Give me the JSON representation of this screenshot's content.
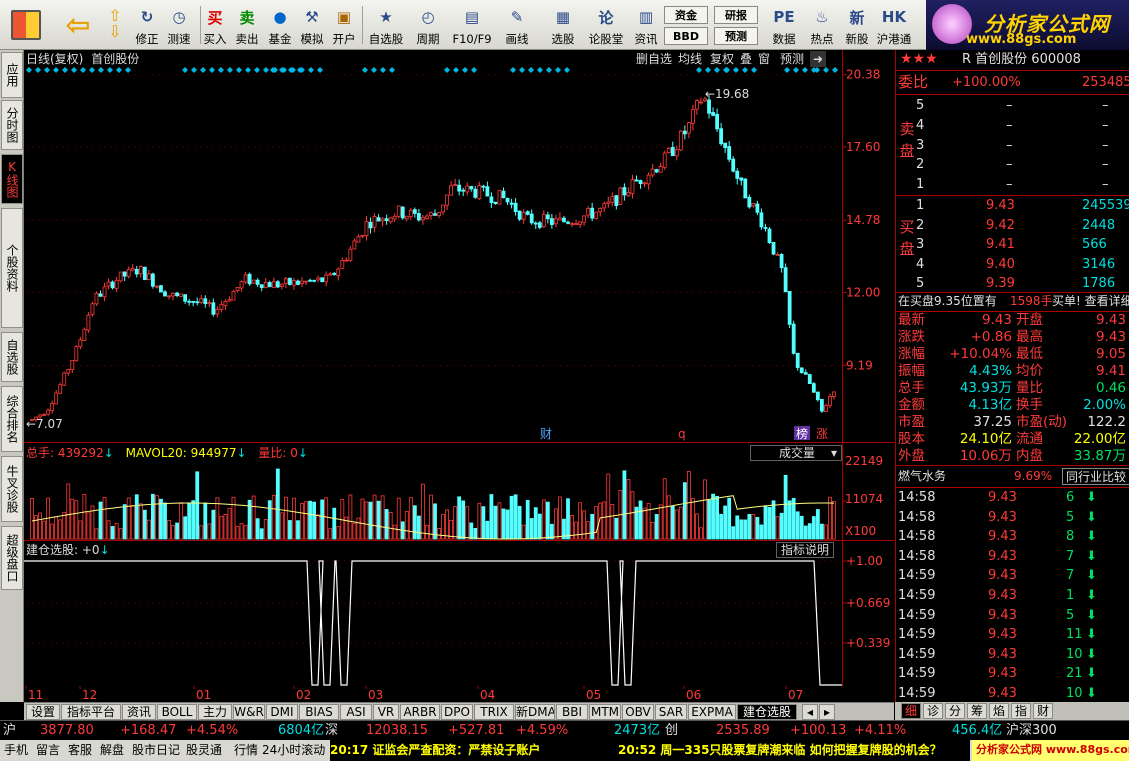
{
  "toolbar": {
    "items": [
      {
        "id": "revise",
        "label": "修正",
        "icon": "revise-icon",
        "glyph": "↻"
      },
      {
        "id": "speed",
        "label": "测速",
        "icon": "clock-icon",
        "glyph": "◷"
      },
      {
        "id": "buy",
        "label": "买入",
        "icon": "buy-icon",
        "glyph": "买"
      },
      {
        "id": "sell",
        "label": "卖出",
        "icon": "sell-icon",
        "glyph": "卖"
      },
      {
        "id": "fund",
        "label": "基金",
        "icon": "fund-icon",
        "glyph": "●"
      },
      {
        "id": "simulate",
        "label": "模拟",
        "icon": "hammer-icon",
        "glyph": "⚒"
      },
      {
        "id": "open_account",
        "label": "开户",
        "icon": "lock-icon",
        "glyph": "▣"
      },
      {
        "id": "watchlist",
        "label": "自选股",
        "icon": "star-folder-icon",
        "glyph": "★"
      },
      {
        "id": "period",
        "label": "周期",
        "icon": "period-icon",
        "glyph": "◴"
      },
      {
        "id": "f10",
        "label": "F10/F9",
        "icon": "f10-icon",
        "glyph": "▤"
      },
      {
        "id": "draw",
        "label": "画线",
        "icon": "pen-icon",
        "glyph": "✎"
      },
      {
        "id": "select",
        "label": "选股",
        "icon": "select-icon",
        "glyph": "▦"
      },
      {
        "id": "forum",
        "label": "论股堂",
        "icon": "forum-icon",
        "glyph": "论"
      },
      {
        "id": "info",
        "label": "资讯",
        "icon": "info-icon",
        "glyph": "▥"
      },
      {
        "id": "data",
        "label": "数据",
        "icon": "pe-icon",
        "glyph": "PE"
      },
      {
        "id": "hot",
        "label": "热点",
        "icon": "fire-icon",
        "glyph": "♨"
      },
      {
        "id": "new_stock",
        "label": "新股",
        "icon": "new-stock-icon",
        "glyph": "新"
      },
      {
        "id": "hk_connect",
        "label": "沪港通",
        "icon": "hk-connect-icon",
        "glyph": "HK"
      }
    ],
    "small_buttons": {
      "funds": "资金",
      "research": "研报",
      "bbd": "BBD",
      "forecast": "预测"
    },
    "brand_title": "分析家公式网",
    "brand_url": "www.88gs.com"
  },
  "left_tabs": [
    "应用",
    "分时图",
    "K线图",
    "个股资料",
    "自选股",
    "综合排名",
    "牛叉诊股",
    "超级盘口"
  ],
  "main_chart": {
    "title": "日线(复权)",
    "stock_name": "首创股份",
    "header_buttons": [
      "删自选",
      "均线",
      "复权",
      "叠",
      "窗",
      "预测"
    ],
    "price_labels": [
      "20.38",
      "17.60",
      "14.78",
      "12.00",
      "9.19"
    ],
    "high_label": "19.68",
    "low_label": "7.07",
    "markers": [
      {
        "text": "财",
        "color": "#4da6ff"
      },
      {
        "text": "q",
        "color": "#ff3a3a"
      },
      {
        "text": "榜",
        "color": "#ffffff"
      },
      {
        "text": "涨",
        "color": "#ff3a3a"
      }
    ]
  },
  "chart_data": {
    "type": "candlestick",
    "y_range": [
      6.9,
      20.6
    ],
    "x_month_labels": [
      "11",
      "12",
      "01",
      "02",
      "03",
      "04",
      "05",
      "06",
      "07"
    ],
    "waypoints": [
      [
        0,
        7.1
      ],
      [
        10,
        7.5
      ],
      [
        20,
        8.6
      ],
      [
        30,
        9.9
      ],
      [
        40,
        11.7
      ],
      [
        55,
        12.5
      ],
      [
        70,
        12.9
      ],
      [
        90,
        11.9
      ],
      [
        110,
        11.6
      ],
      [
        120,
        11.3
      ],
      [
        140,
        12.5
      ],
      [
        160,
        12.3
      ],
      [
        180,
        12.4
      ],
      [
        195,
        12.5
      ],
      [
        205,
        13.3
      ],
      [
        220,
        14.7
      ],
      [
        240,
        15.1
      ],
      [
        255,
        14.9
      ],
      [
        265,
        15.0
      ],
      [
        275,
        16.0
      ],
      [
        290,
        15.9
      ],
      [
        310,
        15.6
      ],
      [
        325,
        14.8
      ],
      [
        345,
        14.7
      ],
      [
        360,
        14.9
      ],
      [
        375,
        15.2
      ],
      [
        395,
        16.2
      ],
      [
        415,
        17.1
      ],
      [
        430,
        18.3
      ],
      [
        440,
        19.6
      ],
      [
        450,
        18.2
      ],
      [
        465,
        16.1
      ],
      [
        480,
        14.6
      ],
      [
        492,
        12.8
      ],
      [
        500,
        9.4
      ],
      [
        510,
        8.5
      ],
      [
        518,
        7.4
      ],
      [
        526,
        8.3
      ]
    ],
    "volume": {
      "label": "总手",
      "value": "439292",
      "ma_label": "MAVOL20",
      "ma_value": "944977",
      "ratio_label": "量比",
      "ratio_value": "0",
      "scale_labels": [
        "22149",
        "11074",
        "X100"
      ]
    },
    "indicator": {
      "label": "建仓选股",
      "value": "+0",
      "scale_labels": [
        "+1.00",
        "+0.669",
        "+0.339"
      ],
      "spike_positions": [
        283,
        295,
        312,
        583,
        596
      ],
      "spike_end": 790
    }
  },
  "volume_dropdown": "成交量",
  "indicator_button": "指标说明",
  "bottom_tabs": [
    "设置",
    "指标平台",
    "资讯",
    "BOLL",
    "主力",
    "W&R",
    "DMI",
    "BIAS",
    "ASI",
    "VR",
    "ARBR",
    "DPO",
    "TRIX",
    "新DMA",
    "BBI",
    "MTM",
    "OBV",
    "SAR",
    "EXPMA",
    "建仓选股"
  ],
  "right_panel": {
    "stars": "★★★",
    "stock_code": "R 首创股份 600008",
    "wei_bi_label": "委比",
    "wei_bi": "+100.00%",
    "wei_cha": "253485",
    "sell_label": "卖盘",
    "buy_label": "买盘",
    "sell_levels": [
      {
        "n": "5",
        "p": "–",
        "v": "–"
      },
      {
        "n": "4",
        "p": "–",
        "v": "–"
      },
      {
        "n": "3",
        "p": "–",
        "v": "–"
      },
      {
        "n": "2",
        "p": "–",
        "v": "–"
      },
      {
        "n": "1",
        "p": "–",
        "v": "–"
      }
    ],
    "buy_levels": [
      {
        "n": "1",
        "p": "9.43",
        "v": "245539"
      },
      {
        "n": "2",
        "p": "9.42",
        "v": "2448"
      },
      {
        "n": "3",
        "p": "9.41",
        "v": "566"
      },
      {
        "n": "4",
        "p": "9.40",
        "v": "3146"
      },
      {
        "n": "5",
        "p": "9.39",
        "v": "1786"
      }
    ],
    "buy_note": "在买盘9.35位置有",
    "buy_note_qty": "1598手",
    "buy_note_link": "买单! 查看详细",
    "stats": [
      {
        "l1": "最新",
        "v1": "9.43",
        "c1": "red",
        "l2": "开盘",
        "v2": "9.43",
        "c2": "red"
      },
      {
        "l1": "涨跌",
        "v1": "+0.86",
        "c1": "red",
        "l2": "最高",
        "v2": "9.43",
        "c2": "red"
      },
      {
        "l1": "涨幅",
        "v1": "+10.04%",
        "c1": "red",
        "l2": "最低",
        "v2": "9.05",
        "c2": "red"
      },
      {
        "l1": "振幅",
        "v1": "4.43%",
        "c1": "cy",
        "l2": "均价",
        "v2": "9.41",
        "c2": "red"
      },
      {
        "l1": "总手",
        "v1": "43.93万",
        "c1": "cy",
        "l2": "量比",
        "v2": "0.46",
        "c2": "grn"
      },
      {
        "l1": "金额",
        "v1": "4.13亿",
        "c1": "cy",
        "l2": "换手",
        "v2": "2.00%",
        "c2": "cy"
      },
      {
        "l1": "市盈",
        "v1": "37.25",
        "c1": "wht",
        "l2": "市盈(动)",
        "v2": "122.2",
        "c2": "wht"
      },
      {
        "l1": "股本",
        "v1": "24.10亿",
        "c1": "yel",
        "l2": "流通",
        "v2": "22.00亿",
        "c2": "yel"
      },
      {
        "l1": "外盘",
        "v1": "10.06万",
        "c1": "red",
        "l2": "内盘",
        "v2": "33.87万",
        "c2": "grn"
      }
    ],
    "sector": "燃气水务",
    "sector_pct": "9.69%",
    "compare_button": "同行业比较",
    "ticks": [
      {
        "t": "14:58",
        "p": "9.43",
        "v": "6"
      },
      {
        "t": "14:58",
        "p": "9.43",
        "v": "5"
      },
      {
        "t": "14:58",
        "p": "9.43",
        "v": "8"
      },
      {
        "t": "14:58",
        "p": "9.43",
        "v": "7"
      },
      {
        "t": "14:59",
        "p": "9.43",
        "v": "7"
      },
      {
        "t": "14:59",
        "p": "9.43",
        "v": "1"
      },
      {
        "t": "14:59",
        "p": "9.43",
        "v": "5"
      },
      {
        "t": "14:59",
        "p": "9.43",
        "v": "11"
      },
      {
        "t": "14:59",
        "p": "9.43",
        "v": "10"
      },
      {
        "t": "14:59",
        "p": "9.43",
        "v": "21"
      },
      {
        "t": "14:59",
        "p": "9.43",
        "v": "10"
      }
    ],
    "tabs": [
      "细",
      "诊",
      "分",
      "筹",
      "焰",
      "指",
      "财"
    ]
  },
  "index_bar": {
    "sh": "沪",
    "sh_val": "3877.80",
    "sh_chg": "+168.47",
    "sh_pct": "+4.54%",
    "sh_amt": "6804亿",
    "sz": "深",
    "sz_val": "12038.15",
    "sz_chg": "+527.81",
    "sz_pct": "+4.59%",
    "sz_amt": "2473亿",
    "cy": "创",
    "cy_val": "2535.89",
    "cy_chg": "+100.13",
    "cy_pct": "+4.11%",
    "hs_amt": "456.4亿",
    "hs": "沪深300"
  },
  "status": {
    "items": [
      "手机",
      "留言",
      "客服",
      "解盘",
      "股市日记",
      "股灵通",
      "行情"
    ],
    "scroll": "24小时滚动",
    "news1": "20:17 证监会严查配资：严禁设子账户",
    "news2": "20:52 周一335只股票复牌潮来临 如何把握复牌股的机会？",
    "ad": "分析家公式网 www.88gs.com"
  }
}
